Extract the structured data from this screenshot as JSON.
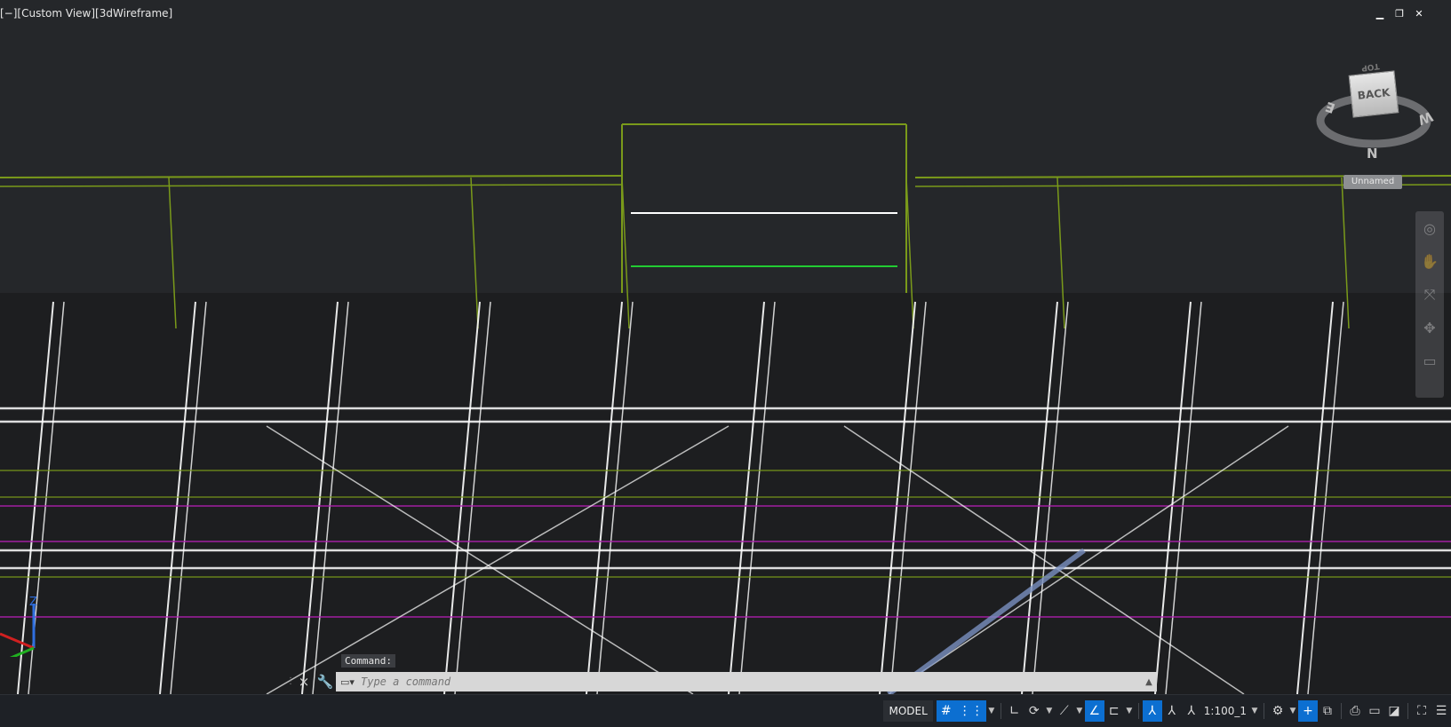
{
  "viewport": {
    "label": "[−][Custom View][3dWireframe]",
    "window_controls": {
      "minimize": "▁",
      "restore": "❐",
      "close": "✕"
    },
    "viewcube": {
      "face": "BACK",
      "top": "TOP",
      "compass": {
        "north": "N",
        "east": "E",
        "west": "W"
      }
    },
    "ucs_name": "Unnamed",
    "navbar_icons": [
      "steering-wheel",
      "pan",
      "zoom",
      "orbit",
      "showmotion"
    ]
  },
  "command_line": {
    "prompt": "Command:",
    "placeholder": "Type a command",
    "close_icon": "×",
    "settings_icon": "🔧"
  },
  "status_bar": {
    "model_label": "MODEL",
    "grid_icon": "#",
    "snap_icon": "⋮⋮",
    "ortho_icon": "∟",
    "polar_icon": "⟳",
    "isodraft_icon": "⟋",
    "osnap_icon": "∠",
    "annoscale": "1:100_1",
    "gear_icon": "⚙",
    "menu_icon": "☰"
  },
  "colors": {
    "background": "#25272a",
    "accent": "#0c6fd1",
    "steel_green": "#7a9a1a",
    "pointcloud_white": "#ffffff",
    "magenta": "#b020b0"
  }
}
